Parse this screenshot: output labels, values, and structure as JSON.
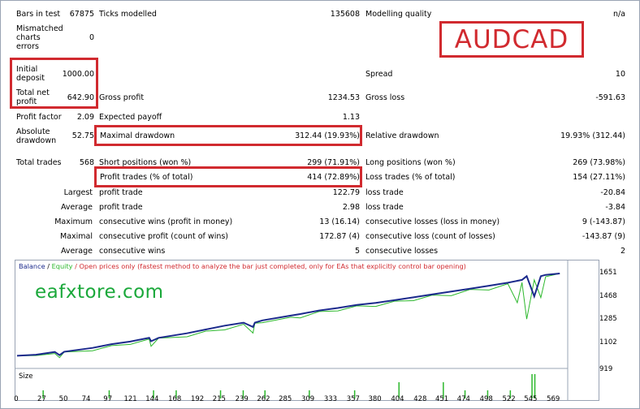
{
  "stats": {
    "bars_in_test_label": "Bars in test",
    "bars_in_test_value": "67875",
    "ticks_modelled_label": "Ticks modelled",
    "ticks_modelled_value": "135608",
    "modelling_quality_label": "Modelling quality",
    "modelling_quality_value": "n/a",
    "mismatched_label_1": "Mismatched",
    "mismatched_label_2": "charts",
    "mismatched_label_3": "errors",
    "mismatched_value": "0",
    "initial_deposit_label_1": "Initial",
    "initial_deposit_label_2": "deposit",
    "initial_deposit_value": "1000.00",
    "spread_label": "Spread",
    "spread_value": "10",
    "total_net_profit_label_1": "Total net",
    "total_net_profit_label_2": "profit",
    "total_net_profit_value": "642.90",
    "gross_profit_label": "Gross profit",
    "gross_profit_value": "1234.53",
    "gross_loss_label": "Gross loss",
    "gross_loss_value": "-591.63",
    "profit_factor_label": "Profit factor",
    "profit_factor_value": "2.09",
    "expected_payoff_label": "Expected payoff",
    "expected_payoff_value": "1.13",
    "absolute_drawdown_label_1": "Absolute",
    "absolute_drawdown_label_2": "drawdown",
    "absolute_drawdown_value": "52.75",
    "maximal_drawdown_label": "Maximal drawdown",
    "maximal_drawdown_value": "312.44 (19.93%)",
    "relative_drawdown_label": "Relative drawdown",
    "relative_drawdown_value": "19.93% (312.44)",
    "total_trades_label": "Total trades",
    "total_trades_value": "568",
    "short_positions_label": "Short positions (won %)",
    "short_positions_value": "299 (71.91%)",
    "long_positions_label": "Long positions (won %)",
    "long_positions_value": "269 (73.98%)",
    "profit_trades_label": "Profit trades (% of total)",
    "profit_trades_value": "414 (72.89%)",
    "loss_trades_label": "Loss trades (% of total)",
    "loss_trades_value": "154 (27.11%)",
    "largest_label": "Largest",
    "largest_profit_label": "profit trade",
    "largest_profit_value": "122.79",
    "largest_loss_label": "loss trade",
    "largest_loss_value": "-20.84",
    "average_label": "Average",
    "average_profit_label": "profit trade",
    "average_profit_value": "2.98",
    "average_loss_label": "loss trade",
    "average_loss_value": "-3.84",
    "maximum_label": "Maximum",
    "max_cons_wins_label": "consecutive wins (profit in money)",
    "max_cons_wins_value": "13 (16.14)",
    "max_cons_losses_label": "consecutive losses (loss in money)",
    "max_cons_losses_value": "9 (-143.87)",
    "maximal_label": "Maximal",
    "maximal_cons_profit_label": "consecutive profit (count of wins)",
    "maximal_cons_profit_value": "172.87 (4)",
    "maximal_cons_loss_label": "consecutive loss (count of losses)",
    "maximal_cons_loss_value": "-143.87 (9)",
    "average2_label": "Average",
    "avg_cons_wins_label": "consecutive wins",
    "avg_cons_wins_value": "5",
    "avg_cons_losses_label": "consecutive losses",
    "avg_cons_losses_value": "2"
  },
  "overlay": {
    "pair": "AUDCAD",
    "watermark": "eafxtore.com",
    "highlight_color": "#d12a2f"
  },
  "graph": {
    "legend_balance": "Balance",
    "legend_sep": " / ",
    "legend_equity": "Equity",
    "legend_note": " / Open prices only (fastest method to analyze the bar just completed, only for EAs that explicitly control bar opening)",
    "size_label": "Size",
    "balance_color": "#1b2a8c",
    "equity_color": "#2db82d",
    "note_color": "#d12a2f",
    "size_bar_color": "#2db82d"
  },
  "chart_data": {
    "type": "line",
    "y_ticks": [
      "1651",
      "1468",
      "1285",
      "1102",
      "919"
    ],
    "ylim": [
      919,
      1651
    ],
    "x_ticks": [
      "0",
      "27",
      "50",
      "74",
      "97",
      "121",
      "144",
      "168",
      "192",
      "215",
      "239",
      "262",
      "285",
      "309",
      "333",
      "357",
      "380",
      "404",
      "428",
      "451",
      "474",
      "498",
      "522",
      "545",
      "569"
    ],
    "xlim": [
      0,
      580
    ],
    "series": [
      {
        "name": "Balance",
        "x": [
          0,
          20,
          40,
          45,
          50,
          80,
          100,
          120,
          140,
          142,
          150,
          180,
          200,
          220,
          240,
          250,
          252,
          260,
          290,
          300,
          320,
          340,
          360,
          380,
          400,
          420,
          440,
          460,
          480,
          500,
          520,
          535,
          540,
          548,
          555,
          560,
          575
        ],
        "values": [
          1000,
          1008,
          1030,
          1005,
          1032,
          1062,
          1092,
          1112,
          1142,
          1115,
          1142,
          1178,
          1208,
          1238,
          1262,
          1228,
          1262,
          1280,
          1318,
          1330,
          1358,
          1378,
          1402,
          1418,
          1440,
          1462,
          1486,
          1508,
          1530,
          1554,
          1578,
          1600,
          1630,
          1470,
          1630,
          1640,
          1651
        ]
      },
      {
        "name": "Equity",
        "x": [
          0,
          20,
          40,
          45,
          50,
          80,
          100,
          120,
          140,
          142,
          150,
          180,
          200,
          220,
          240,
          250,
          252,
          260,
          290,
          300,
          320,
          340,
          360,
          380,
          400,
          420,
          440,
          460,
          480,
          500,
          520,
          530,
          535,
          540,
          548,
          555,
          560,
          575
        ],
        "values": [
          1000,
          1002,
          1018,
          985,
          1030,
          1040,
          1080,
          1090,
          1132,
          1075,
          1140,
          1150,
          1195,
          1205,
          1250,
          1180,
          1258,
          1262,
          1305,
          1300,
          1350,
          1355,
          1395,
          1390,
          1432,
          1436,
          1480,
          1475,
          1525,
          1520,
          1570,
          1420,
          1580,
          1290,
          1600,
          1460,
          1625,
          1651
        ]
      }
    ],
    "size_bars_x": [
      27,
      97,
      144,
      168,
      215,
      239,
      262,
      309,
      357,
      404,
      451,
      474,
      498,
      522,
      545,
      548
    ],
    "size_bars_values": [
      1,
      1,
      1,
      1,
      1,
      1,
      1,
      1,
      1,
      2,
      2,
      1,
      1,
      1,
      3,
      3
    ]
  }
}
